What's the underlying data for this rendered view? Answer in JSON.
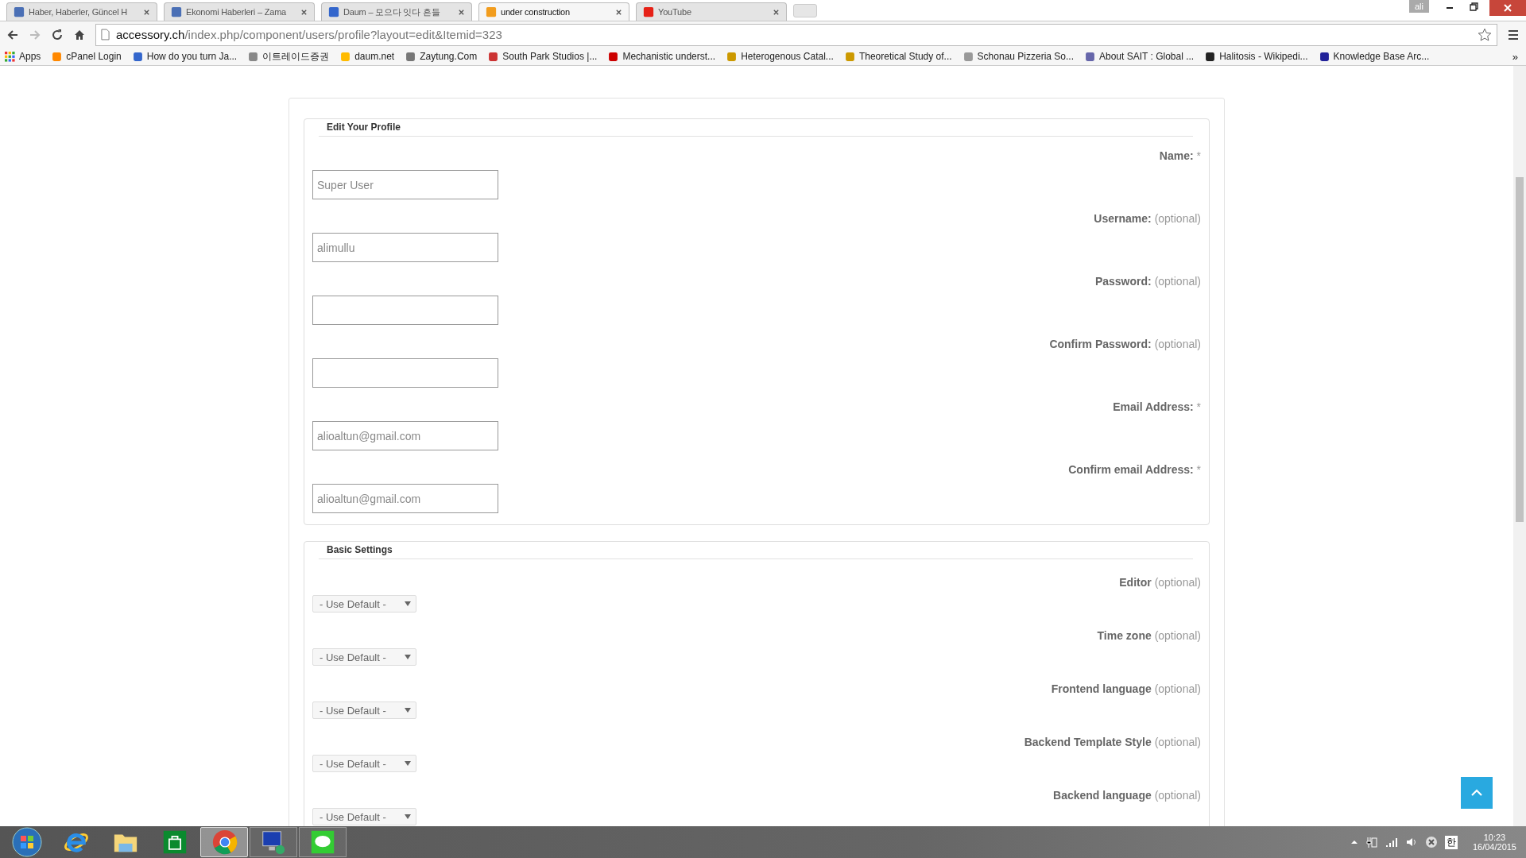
{
  "tabs": [
    {
      "title": "Haber, Haberler, Güncel H",
      "selected": false
    },
    {
      "title": "Ekonomi Haberleri – Zama",
      "selected": false
    },
    {
      "title": "Daum – 모으다 잇다 흔들",
      "selected": false
    },
    {
      "title": "under construction",
      "selected": true
    },
    {
      "title": "YouTube",
      "selected": false
    }
  ],
  "profile_badge": "ali",
  "address": {
    "host": "accessory.ch",
    "path": "/index.php/component/users/profile?layout=edit&Itemid=323"
  },
  "bookmarks": [
    "Apps",
    "cPanel Login",
    "How do you turn Ja...",
    "이트레이드증권",
    "daum.net",
    "Zaytung.Com",
    "South Park Studios |...",
    "Mechanistic underst...",
    "Heterogenous Catal...",
    "Theoretical Study of...",
    "Schonau Pizzeria So...",
    "About SAIT : Global ...",
    "Halitosis - Wikipedi...",
    "Knowledge Base Arc..."
  ],
  "bookmarks_more": "»",
  "profile_section": {
    "legend": "Edit Your Profile",
    "fields": [
      {
        "label": "Name:",
        "note": "*",
        "value": "Super User"
      },
      {
        "label": "Username:",
        "note": "(optional)",
        "value": "alimullu"
      },
      {
        "label": "Password:",
        "note": "(optional)"
      },
      {
        "label": "Confirm Password:",
        "note": "(optional)"
      },
      {
        "label": "Email Address:",
        "note": "*",
        "value": "alioaltun@gmail.com"
      },
      {
        "label": "Confirm email Address:",
        "note": "*",
        "value": "alioaltun@gmail.com"
      }
    ]
  },
  "basic_settings": {
    "legend": "Basic Settings",
    "fields": [
      {
        "label": "Editor",
        "note": "(optional)",
        "value": "- Use Default -"
      },
      {
        "label": "Time zone",
        "note": "(optional)",
        "value": "- Use Default -"
      },
      {
        "label": "Frontend language",
        "note": "(optional)",
        "value": "- Use Default -"
      },
      {
        "label": "Backend Template Style",
        "note": "(optional)",
        "value": "- Use Default -"
      },
      {
        "label": "Backend language",
        "note": "(optional)",
        "value": "- Use Default -"
      }
    ]
  },
  "taskbar": [
    {
      "kind": "start",
      "running": false,
      "selected": false
    },
    {
      "kind": "ie",
      "running": false,
      "selected": false
    },
    {
      "kind": "explorer",
      "running": false,
      "selected": false
    },
    {
      "kind": "store",
      "running": false,
      "selected": false
    },
    {
      "kind": "chrome",
      "running": true,
      "selected": true
    },
    {
      "kind": "remote",
      "running": true,
      "selected": false
    },
    {
      "kind": "line",
      "running": true,
      "selected": false
    }
  ],
  "tray": {
    "time": "10:23",
    "date": "16/04/2015",
    "ime": "한"
  }
}
